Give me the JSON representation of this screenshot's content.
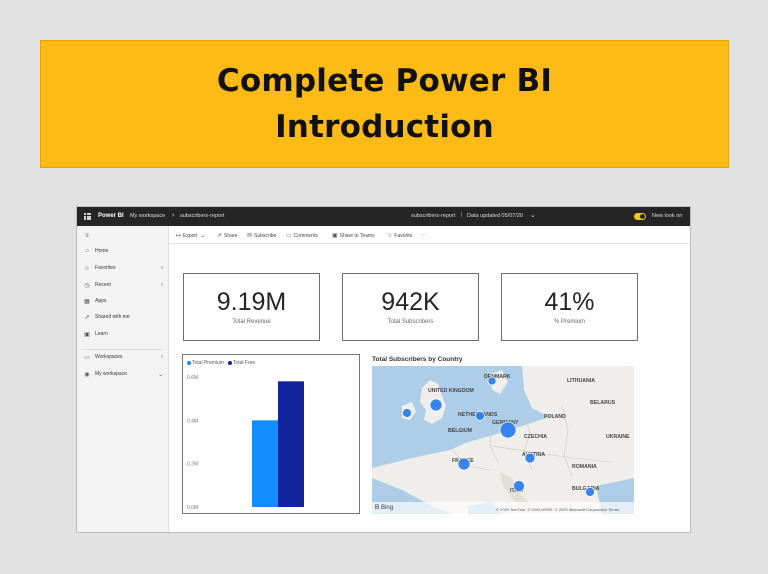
{
  "banner": {
    "line1": "Complete Power BI",
    "line2": "Introduction"
  },
  "topbar": {
    "brand": "Power BI",
    "breadcrumb": [
      "My workspace",
      "subscribers-report"
    ],
    "report_title": "subscribers-report",
    "updated": "Data updated 05/07/20",
    "new_look": "New look on"
  },
  "sidebar": {
    "items": [
      {
        "icon": "home-icon",
        "label": "Home",
        "chevron": false
      },
      {
        "icon": "star-icon",
        "label": "Favorites",
        "chevron": true
      },
      {
        "icon": "clock-icon",
        "label": "Recent",
        "chevron": true
      },
      {
        "icon": "apps-icon",
        "label": "Apps",
        "chevron": false
      },
      {
        "icon": "share-icon",
        "label": "Shared with me",
        "chevron": false
      },
      {
        "icon": "book-icon",
        "label": "Learn",
        "chevron": false
      },
      {
        "icon": "workspaces-icon",
        "label": "Workspaces",
        "chevron": true
      },
      {
        "icon": "user-icon",
        "label": "My workspace",
        "chevron": true
      }
    ]
  },
  "toolbar": {
    "export": "Export",
    "share": "Share",
    "subscribe": "Subscribe",
    "comments": "Comments",
    "teams": "Share to Teams",
    "favorite": "Favorite",
    "more": "···"
  },
  "kpis": [
    {
      "value": "9.19M",
      "label": "Total Revenue"
    },
    {
      "value": "942K",
      "label": "Total Subscribers"
    },
    {
      "value": "41%",
      "label": "% Premium"
    }
  ],
  "chart_data": {
    "type": "bar",
    "title": "",
    "categories": [
      ""
    ],
    "series": [
      {
        "name": "Total Premium",
        "values": [
          0.4
        ],
        "color": "#118dff"
      },
      {
        "name": "Total Free",
        "values": [
          0.58
        ],
        "color": "#12239e"
      }
    ],
    "yticks": [
      "0.6M",
      "0.4M",
      "0.2M",
      "0.0M"
    ],
    "ylim": [
      0,
      0.6
    ],
    "grid": false,
    "legend_position": "top-left"
  },
  "map": {
    "title": "Total Subscribers by Country",
    "bing": "Bing",
    "copyright": "© 2020 TomTom, © 2020 HERE, © 2020 Microsoft Corporation Terms",
    "labels": [
      "UNITED KINGDOM",
      "DENMARK",
      "LITHUANIA",
      "BELARUS",
      "NETHERLANDS",
      "POLAND",
      "BELGIUM",
      "GERMANY",
      "CZECHIA",
      "UKRAINE",
      "AUSTRIA",
      "FRANCE",
      "ROMANIA",
      "ITALY",
      "BULGARIA"
    ]
  },
  "colors": {
    "banner": "#fbbb14",
    "topbar": "#252525",
    "premium": "#118dff",
    "free": "#12239e",
    "bubble": "#2f80ed",
    "accent_toggle": "#f2c811"
  }
}
